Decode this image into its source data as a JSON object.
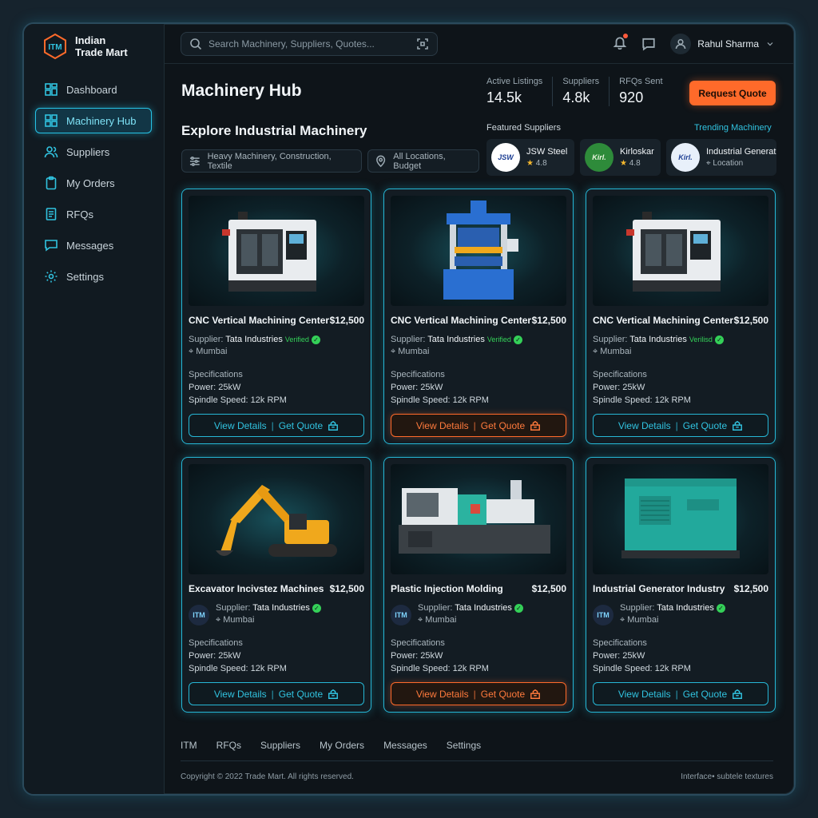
{
  "brand": {
    "logo_text": "ITM",
    "line1": "Indian",
    "line2": "Trade Mart"
  },
  "sidebar": {
    "items": [
      {
        "label": "Dashboard",
        "icon": "dashboard-icon"
      },
      {
        "label": "Machinery Hub",
        "icon": "grid-icon",
        "active": true
      },
      {
        "label": "Suppliers",
        "icon": "users-icon"
      },
      {
        "label": "My Orders",
        "icon": "clipboard-icon"
      },
      {
        "label": "RFQs",
        "icon": "document-icon"
      },
      {
        "label": "Messages",
        "icon": "chat-icon"
      },
      {
        "label": "Settings",
        "icon": "gear-icon"
      }
    ]
  },
  "topbar": {
    "search_placeholder": "Search Machinery, Suppliers, Quotes...",
    "user_name": "Rahul Sharma"
  },
  "header": {
    "title": "Machinery Hub",
    "stats": [
      {
        "label": "Active Listings",
        "value": "14.5k"
      },
      {
        "label": "Suppliers",
        "value": "4.8k"
      },
      {
        "label": "RFQs Sent",
        "value": "920"
      }
    ],
    "request_quote": "Request Quote",
    "explore_title": "Explore Industrial Machinery",
    "filter_category": "Heavy Machinery, Construction, Textile",
    "filter_location": "All Locations, Budget",
    "featured_label": "Featured Suppliers",
    "trending_label": "Trending Machinery"
  },
  "featured_suppliers": [
    {
      "name": "JSW Steel",
      "sub": "4.8",
      "logo": "JSW",
      "color": "#ffffff"
    },
    {
      "name": "Kirloskar",
      "sub": "4.8",
      "logo": "Kirloskar",
      "color": "#2e8b3a"
    },
    {
      "name": "Industrial Generat",
      "sub": "Location",
      "logo": "Kirloskar",
      "color": "#e8f0fa"
    }
  ],
  "products": [
    {
      "title": "CNC Vertical Machining Center",
      "price": "$12,500",
      "supplier_label": "Supplier:",
      "supplier": "Tata Industries",
      "verified": "Verified",
      "location": "Mumbai",
      "specs_label": "Specifications",
      "power": "Power: 25kW",
      "spindle": "Spindle Speed: 12k RPM",
      "view": "View Details",
      "quote": "Get Quote",
      "image": "cnc",
      "highlight": false
    },
    {
      "title": "CNC Vertical Machining Center",
      "price": "$12,500",
      "supplier_label": "Supplier:",
      "supplier": "Tata Industries",
      "verified": "Verified",
      "location": "Mumbai",
      "specs_label": "Specifications",
      "power": "Power: 25kW",
      "spindle": "Spindle Speed: 12k RPM",
      "view": "View Details",
      "quote": "Get Quote",
      "image": "press",
      "highlight": true
    },
    {
      "title": "CNC Vertical Machining Center",
      "price": "$12,500",
      "supplier_label": "Supplier:",
      "supplier": "Tata Industries",
      "verified": "Verilisd",
      "location": "Mumbai",
      "specs_label": "Specifications",
      "power": "Power: 25kW",
      "spindle": "Spindle Speed: 12k RPM",
      "view": "View Details",
      "quote": "Get Quote",
      "image": "cnc",
      "highlight": false
    },
    {
      "title": "Excavator Incivstez Machines",
      "price": "$12,500",
      "supplier_label": "Supplier:",
      "supplier": "Tata Industries",
      "verified": "",
      "location": "Mumbai",
      "specs_label": "Specifications",
      "power": "Power: 25kW",
      "spindle": "Spindle Speed: 12k RPM",
      "view": "View Details",
      "quote": "Get Quote",
      "image": "excavator",
      "highlight": false,
      "mini_logo": "ITM"
    },
    {
      "title": "Plastic Injection Molding",
      "price": "$12,500",
      "supplier_label": "Supplier:",
      "supplier": "Tata Industries",
      "verified": "",
      "location": "Mumbai",
      "specs_label": "Specifications",
      "power": "Power: 25kW",
      "spindle": "Spindle Speed: 12k RPM",
      "view": "View Details",
      "quote": "Get Quote",
      "image": "injection",
      "highlight": true,
      "mini_logo": "ITM"
    },
    {
      "title": "Industrial Generator Industry",
      "price": "$12,500",
      "supplier_label": "Supplier:",
      "supplier": "Tata Industries",
      "verified": "",
      "location": "Mumbai",
      "specs_label": "Specifications",
      "power": "Power: 25kW",
      "spindle": "Spindle Speed: 12k RPM",
      "view": "View Details",
      "quote": "Get Quote",
      "image": "generator",
      "highlight": false,
      "mini_logo": "ITM"
    }
  ],
  "footer": {
    "links": [
      "ITM",
      "RFQs",
      "Suppliers",
      "My Orders",
      "Messages",
      "Settings"
    ],
    "copyright": "Copyright © 2022 Trade Mart. All rights reserved.",
    "note": "Interface• subtele textures"
  },
  "colors": {
    "accent": "#26c3e6",
    "orange": "#ff6a2a",
    "verified": "#34d058"
  }
}
